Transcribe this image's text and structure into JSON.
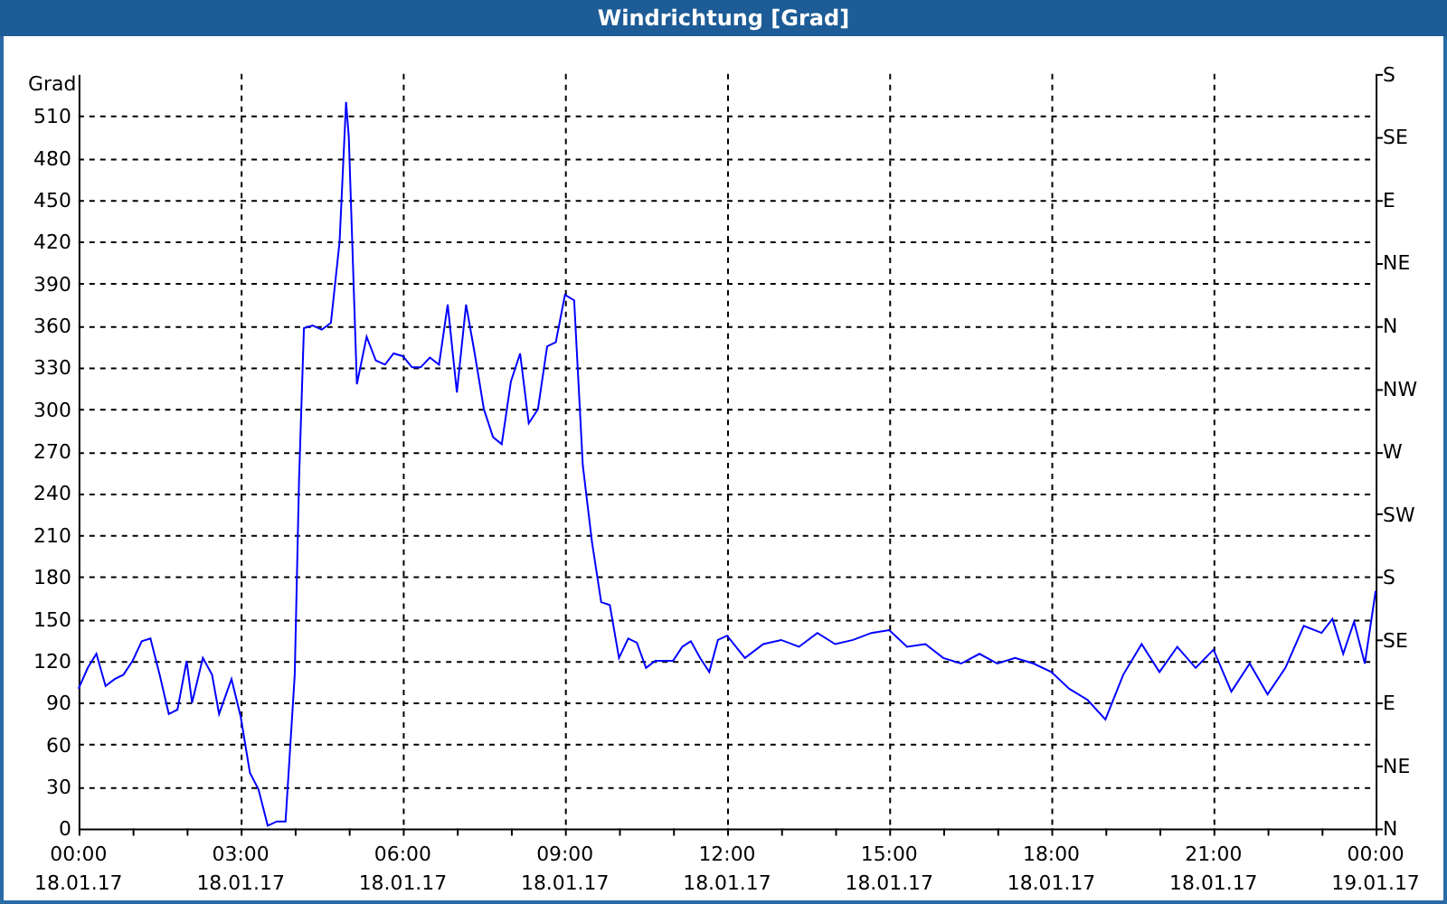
{
  "window": {
    "title": "Windrichtung [Grad]"
  },
  "chart": {
    "compass_axis_labels": [
      "S",
      "SE",
      "E",
      "NE",
      "N",
      "NW",
      "W",
      "SW",
      "S",
      "SE",
      "E",
      "NE",
      "N"
    ],
    "chart_data": {
      "type": "line",
      "ylabel": "Grad",
      "xlim": [
        0,
        24
      ],
      "ylim": [
        0,
        540
      ],
      "yticks": [
        0,
        30,
        60,
        90,
        120,
        150,
        180,
        210,
        240,
        270,
        300,
        330,
        360,
        390,
        420,
        450,
        480,
        510
      ],
      "grid": true,
      "xticks": [
        {
          "value": 0,
          "label": "00:00"
        },
        {
          "value": 3,
          "label": "03:00"
        },
        {
          "value": 6,
          "label": "06:00"
        },
        {
          "value": 9,
          "label": "09:00"
        },
        {
          "value": 12,
          "label": "12:00"
        },
        {
          "value": 15,
          "label": "15:00"
        },
        {
          "value": 18,
          "label": "18:00"
        },
        {
          "value": 21,
          "label": "21:00"
        },
        {
          "value": 24,
          "label": "00:00"
        }
      ],
      "annotations": [
        "18.01.17",
        "18.01.17",
        "18.01.17",
        "18.01.17",
        "18.01.17",
        "18.01.17",
        "18.01.17",
        "18.01.17",
        "19.01.17"
      ],
      "x": [
        0,
        0.17,
        0.33,
        0.5,
        0.67,
        0.83,
        1,
        1.17,
        1.33,
        1.5,
        1.67,
        1.83,
        2,
        2.1,
        2.3,
        2.47,
        2.6,
        2.83,
        3,
        3.17,
        3.33,
        3.5,
        3.67,
        3.83,
        4,
        4.08,
        4.17,
        4.33,
        4.5,
        4.67,
        4.83,
        4.95,
        5,
        5.15,
        5.33,
        5.5,
        5.67,
        5.83,
        6,
        6.17,
        6.33,
        6.5,
        6.67,
        6.83,
        7,
        7.17,
        7.33,
        7.5,
        7.67,
        7.83,
        8,
        8.17,
        8.33,
        8.5,
        8.67,
        8.83,
        9,
        9.17,
        9.33,
        9.5,
        9.67,
        9.83,
        10,
        10.17,
        10.33,
        10.5,
        10.67,
        10.83,
        11,
        11.17,
        11.33,
        11.5,
        11.67,
        11.83,
        12,
        12.33,
        12.67,
        13,
        13.33,
        13.67,
        14,
        14.33,
        14.67,
        15,
        15.33,
        15.67,
        16,
        16.33,
        16.67,
        17,
        17.33,
        17.67,
        18,
        18.33,
        18.67,
        19,
        19.33,
        19.67,
        20,
        20.33,
        20.67,
        21,
        21.33,
        21.67,
        22,
        22.33,
        22.67,
        23,
        23.2,
        23.4,
        23.6,
        23.8,
        24
      ],
      "series": [
        {
          "color": "#0000ff",
          "values": [
            100,
            115,
            125,
            102,
            107,
            110,
            120,
            134,
            136,
            110,
            82,
            85,
            120,
            90,
            122,
            110,
            82,
            107,
            80,
            40,
            28,
            2,
            5,
            5,
            110,
            250,
            358,
            360,
            357,
            362,
            420,
            520,
            495,
            318,
            352,
            335,
            332,
            340,
            338,
            330,
            330,
            337,
            332,
            375,
            312,
            375,
            340,
            300,
            280,
            275,
            320,
            340,
            290,
            300,
            345,
            348,
            382,
            378,
            260,
            205,
            162,
            160,
            122,
            136,
            133,
            115,
            120,
            120,
            120,
            130,
            134,
            122,
            112,
            135,
            138,
            122,
            132,
            135,
            130,
            140,
            132,
            135,
            140,
            142,
            130,
            132,
            122,
            118,
            125,
            118,
            122,
            118,
            112,
            100,
            92,
            78,
            110,
            132,
            112,
            130,
            115,
            128,
            98,
            118,
            96,
            115,
            145,
            140,
            150,
            125,
            148,
            118,
            170
          ]
        }
      ]
    }
  }
}
